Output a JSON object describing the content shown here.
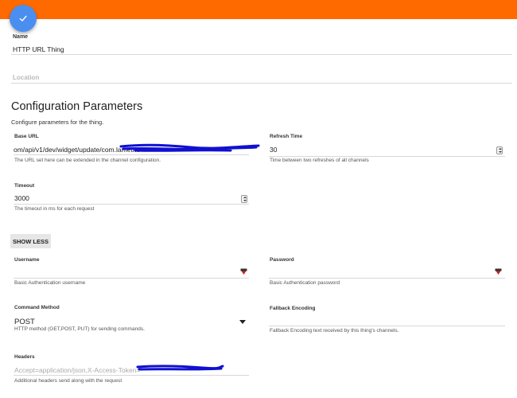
{
  "header": {
    "save_icon": "check-icon",
    "accent_color": "#ff6a00",
    "fab_color": "#4a8ef0"
  },
  "name": {
    "label": "Name",
    "value": "HTTP URL Thing"
  },
  "location": {
    "placeholder": "Location"
  },
  "config": {
    "title": "Configuration Parameters",
    "subtitle": "Configure parameters for the thing."
  },
  "base_url": {
    "label": "Base URL",
    "value": "om/api/v1/dev/widget/update/com.lametric",
    "hint": "The URL set here can be extended in the channel configuration."
  },
  "refresh_time": {
    "label": "Refresh Time",
    "value": "30",
    "hint": "Time between two refreshes of all channels"
  },
  "timeout": {
    "label": "Timeout",
    "value": "3000",
    "hint": "The timeout in ms for each request"
  },
  "show_less": {
    "label": "SHOW LESS"
  },
  "username": {
    "label": "Username",
    "value": "",
    "hint": "Basic Authentication username"
  },
  "password": {
    "label": "Password",
    "value": "",
    "hint": "Basic Authentication password"
  },
  "command_method": {
    "label": "Command Method",
    "value": "POST",
    "hint": "HTTP method (GET,POST, PUT) for sending commands."
  },
  "fallback_encoding": {
    "label": "Fallback Encoding",
    "value": "",
    "hint": "Fallback Encoding text received by this thing's channels."
  },
  "headers": {
    "label": "Headers",
    "value": "Accept=application/json,X-Access-Token=",
    "hint": "Additional headers send along with the request"
  }
}
